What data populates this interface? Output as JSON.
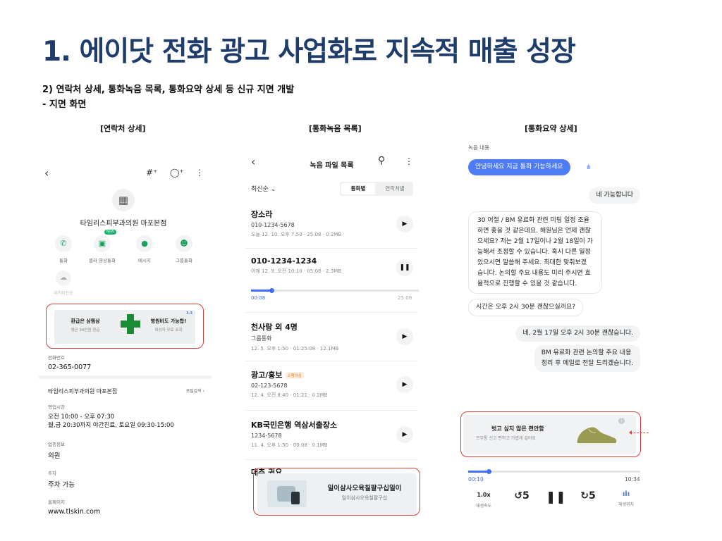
{
  "title": "1. 에이닷 전화 광고 사업화로 지속적 매출 성장",
  "subtitle": {
    "line1": "2) 연락처 상세, 통화녹음 목록, 통화요약 상세 등 신규 지면 개발",
    "line2": "- 지면 화면"
  },
  "sections": {
    "contact": "[연락처 상세]",
    "recordings": "[통화녹음 목록]",
    "summary": "[통화요약 상세]"
  },
  "contact_detail": {
    "business_name": "타임리스피부과의원 마포본점",
    "actions": [
      {
        "label": "통화",
        "icon": "phone-icon"
      },
      {
        "label": "클라 영상통화",
        "icon": "video-icon",
        "badge": "NEW"
      },
      {
        "label": "메시지",
        "icon": "message-icon"
      },
      {
        "label": "그룹통화",
        "icon": "group-icon"
      },
      {
        "label": "데이터전송",
        "icon": "data-icon"
      }
    ],
    "ad": {
      "left_title": "환급은 삼쩜삼",
      "left_sub": "평균 34만원 환급",
      "right_title": "병원비도 가능합!",
      "right_sub": "대상자 무료 조회",
      "mark": "3.3"
    },
    "phone_label": "전화번호",
    "phone": "02-365-0077",
    "biz_name_row": "타임리스피부과의원 마포본점",
    "map_link": "포털검색",
    "hours_label": "영업시간",
    "hours_line1": "오전 10:00 - 오후 07:30",
    "hours_line2": "월,금 20:30까지 야간진료, 토요일 09:30-15:00",
    "category_label": "업종정보",
    "category": "의원",
    "parking_label": "주차",
    "parking": "주차 가능",
    "homepage_label": "홈페이지",
    "homepage": "www.tlskin.com"
  },
  "recording_list": {
    "header": "녹음 파일 목록",
    "sort": "최신순",
    "tabs": [
      "통화별",
      "연락처별"
    ],
    "items": [
      {
        "name": "장소라",
        "phone": "010-1234-5678",
        "meta": "오늘 12. 10. 오후 7:50 · 25:08 · 0.2MB",
        "state": "play"
      },
      {
        "name": "010-1234-1234",
        "phone": "",
        "meta": "어제 12. 9. 오전 10:10 · 05:08 · 2.3MB",
        "state": "pause"
      },
      {
        "name": "천사랑 외 4명",
        "phone": "그룹통화",
        "meta": "12. 5. 오후 1:50 · 01:25:08 · 12.1MB",
        "state": "play"
      },
      {
        "name": "광고/홍보",
        "tag": "스팸의심",
        "phone": "02-123-5678",
        "meta": "12. 4. 오전 8:40 · 01:21 · 0.2MB",
        "state": "play"
      },
      {
        "name": "KB국민은행 역삼서출장소",
        "phone": "1234-5678",
        "meta": "11. 4. 오후 1:50 · 00:08 · 0.1MB",
        "state": "play"
      }
    ],
    "partial_item": "대추 귀요",
    "playback": {
      "current": "00:08",
      "total": "25:08",
      "progress": 0.12
    },
    "ad": {
      "title": "일이삼사오육칠팔구십일이",
      "sub": "일이삼사오육칠팔구십"
    }
  },
  "call_summary": {
    "section_label": "녹음 내용",
    "messages": [
      {
        "side": "left",
        "style": "blue",
        "text": "안녕하세요 지금 통화 가능하세요"
      },
      {
        "side": "right",
        "style": "gray",
        "text": "네 가능합니다"
      },
      {
        "side": "left",
        "style": "white",
        "lines": [
          "30 어절 / BM 유료화 관련 미팅 일정 조율",
          "하면 좋을 것 같은데요. 해원님은 언제 괜찮",
          "으세요? 저는 2월 17일이나 2월 18일이 가",
          "능해서 조정할 수 있습니다. 혹시 다른 일정",
          "있으시면 말씀해 주세요. 최대한 맞춰보겠",
          "습니다. 논의할 주요 내용도 미리 주시면 효",
          "율적으로 진행할 수 있을 것 같습니다."
        ]
      },
      {
        "side": "left",
        "style": "white",
        "text": "시간은 오후 2시 30분 괜찮으실까요?"
      },
      {
        "side": "right",
        "style": "gray",
        "text": "네, 2월 17일 오후 2시 30분 괜찮습니다."
      },
      {
        "side": "right",
        "style": "gray",
        "lines": [
          "BM 유료화 관련 논의할 주요 내용",
          "정리 후 메일로 전달 드리겠습니다."
        ]
      }
    ],
    "ad": {
      "title": "벗고 싶지 않은 편안함",
      "sub": "르무통 신고 편하고 가볍게 걸어요"
    },
    "playback": {
      "current": "00:10",
      "total": "10:34",
      "progress": 0.12
    },
    "controls": [
      {
        "icon": "speed-icon",
        "text": "1.0x",
        "label": "재생속도"
      },
      {
        "icon": "rewind-5-icon",
        "text": "↺5"
      },
      {
        "icon": "pause-icon",
        "text": "❚❚"
      },
      {
        "icon": "forward-5-icon",
        "text": "↻5"
      },
      {
        "icon": "waveform-icon",
        "text": "ılı",
        "label": "재생위치"
      }
    ]
  }
}
